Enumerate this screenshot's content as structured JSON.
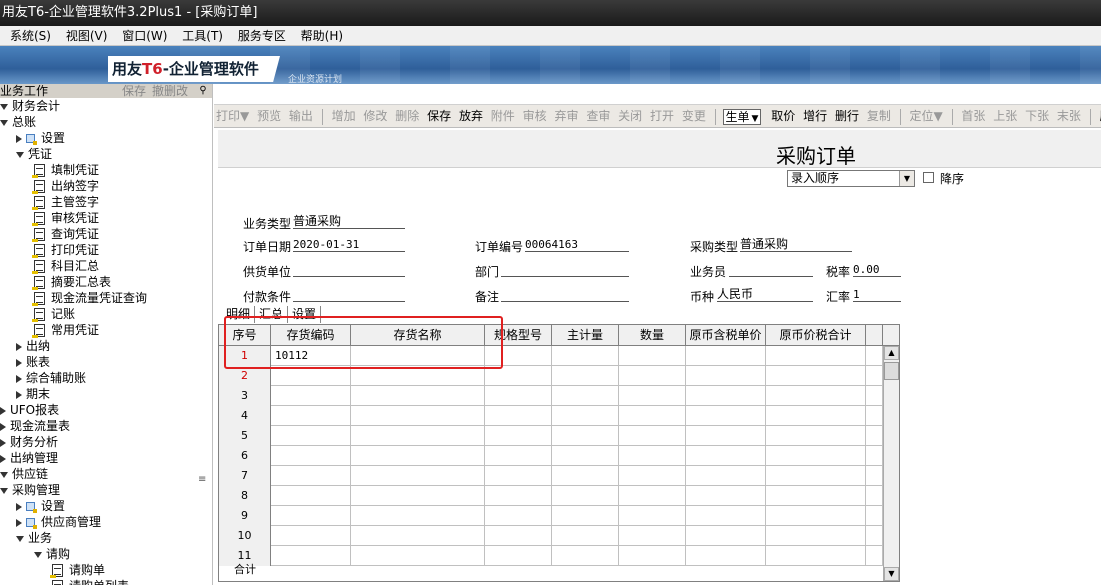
{
  "window": {
    "title": "用友T6-企业管理软件3.2Plus1  - [采购订单]"
  },
  "menu": [
    "系统(S)",
    "视图(V)",
    "窗口(W)",
    "工具(T)",
    "服务专区",
    "帮助(H)"
  ],
  "banner": {
    "logo_pre": "用友",
    "logo_t6": "T6",
    "logo_post": "-企业管理软件",
    "sub": "企业资源计划"
  },
  "nav": {
    "header": "业务工作",
    "save": "保存",
    "undo": "撤删改",
    "items": [
      {
        "label": "财务会计",
        "level": 0,
        "state": "down",
        "icon": "none"
      },
      {
        "label": "总账",
        "level": 1,
        "state": "down",
        "icon": "none"
      },
      {
        "label": "设置",
        "level": 2,
        "state": "right",
        "icon": "folder"
      },
      {
        "label": "凭证",
        "level": 2,
        "state": "down",
        "icon": "none"
      },
      {
        "label": "填制凭证",
        "level": 3,
        "state": "leaf",
        "icon": "doc"
      },
      {
        "label": "出纳签字",
        "level": 3,
        "state": "leaf",
        "icon": "doc"
      },
      {
        "label": "主管签字",
        "level": 3,
        "state": "leaf",
        "icon": "doc"
      },
      {
        "label": "审核凭证",
        "level": 3,
        "state": "leaf",
        "icon": "doc"
      },
      {
        "label": "查询凭证",
        "level": 3,
        "state": "leaf",
        "icon": "doc"
      },
      {
        "label": "打印凭证",
        "level": 3,
        "state": "leaf",
        "icon": "doc"
      },
      {
        "label": "科目汇总",
        "level": 3,
        "state": "leaf",
        "icon": "doc"
      },
      {
        "label": "摘要汇总表",
        "level": 3,
        "state": "leaf",
        "icon": "doc"
      },
      {
        "label": "现金流量凭证查询",
        "level": 3,
        "state": "leaf",
        "icon": "doc"
      },
      {
        "label": "记账",
        "level": 3,
        "state": "leaf",
        "icon": "doc"
      },
      {
        "label": "常用凭证",
        "level": 3,
        "state": "leaf",
        "icon": "doc"
      },
      {
        "label": "出纳",
        "level": 2,
        "state": "right",
        "icon": "none"
      },
      {
        "label": "账表",
        "level": 2,
        "state": "right",
        "icon": "none"
      },
      {
        "label": "综合辅助账",
        "level": 2,
        "state": "right",
        "icon": "none"
      },
      {
        "label": "期末",
        "level": 2,
        "state": "right",
        "icon": "none"
      },
      {
        "label": "UFO报表",
        "level": 1,
        "state": "right",
        "icon": "none"
      },
      {
        "label": "现金流量表",
        "level": 1,
        "state": "right",
        "icon": "none"
      },
      {
        "label": "财务分析",
        "level": 1,
        "state": "right",
        "icon": "none"
      },
      {
        "label": "出纳管理",
        "level": 1,
        "state": "right",
        "icon": "none"
      },
      {
        "label": "供应链",
        "level": 0,
        "state": "down",
        "icon": "none"
      },
      {
        "label": "采购管理",
        "level": 1,
        "state": "down",
        "icon": "none"
      },
      {
        "label": "设置",
        "level": 2,
        "state": "right",
        "icon": "folder"
      },
      {
        "label": "供应商管理",
        "level": 2,
        "state": "right",
        "icon": "folder"
      },
      {
        "label": "业务",
        "level": 2,
        "state": "down",
        "icon": "none"
      },
      {
        "label": "请购",
        "level": 3,
        "state": "down",
        "icon": "none"
      },
      {
        "label": "请购单",
        "level": 4,
        "state": "leaf",
        "icon": "doc"
      },
      {
        "label": "请购单列表",
        "level": 4,
        "state": "leaf",
        "icon": "doc"
      }
    ]
  },
  "toolbar": {
    "print": "打印▼",
    "preview": "预览",
    "output": "输出",
    "add": "增加",
    "modify": "修改",
    "delete": "删除",
    "save": "保存",
    "abandon": "放弃",
    "attach": "附件",
    "audit": "审核",
    "unaudit": "弃审",
    "check": "查审",
    "close": "关闭",
    "open": "打开",
    "change": "变更",
    "generate": "生单",
    "price": "取价",
    "addrow": "增行",
    "delrow": "删行",
    "copy": "复制",
    "locate": "定位▼",
    "first": "首张",
    "prev": "上张",
    "next": "下张",
    "last": "末张",
    "refresh": "刷新"
  },
  "form": {
    "title": "采购订单",
    "sort": "录入顺序",
    "desc_label": "降序",
    "fields": {
      "biz_type_label": "业务类型",
      "biz_type": "普通采购",
      "date_label": "订单日期",
      "date": "2020-01-31",
      "order_no_label": "订单编号",
      "order_no": "00064163",
      "purchase_type_label": "采购类型",
      "purchase_type": "普通采购",
      "supplier_label": "供货单位",
      "supplier": "",
      "dept_label": "部门",
      "dept": "",
      "staff_label": "业务员",
      "staff": "",
      "tax_label": "税率",
      "tax": "0.00",
      "pay_label": "付款条件",
      "pay": "",
      "note_label": "备注",
      "note": "",
      "currency_label": "币种",
      "currency": "人民币",
      "rate_label": "汇率",
      "rate": "1"
    },
    "tabs": [
      "明细",
      "汇总",
      "设置"
    ]
  },
  "grid": {
    "columns": [
      "序号",
      "存货编码",
      "存货名称",
      "规格型号",
      "主计量",
      "数量",
      "原币含税单价",
      "原币价税合计"
    ],
    "rows": [
      {
        "n": "1",
        "code": "10112"
      },
      {
        "n": "2",
        "code": ""
      },
      {
        "n": "3",
        "code": ""
      },
      {
        "n": "4",
        "code": ""
      },
      {
        "n": "5",
        "code": ""
      },
      {
        "n": "6",
        "code": ""
      },
      {
        "n": "7",
        "code": ""
      },
      {
        "n": "8",
        "code": ""
      },
      {
        "n": "9",
        "code": ""
      },
      {
        "n": "10",
        "code": ""
      },
      {
        "n": "11",
        "code": ""
      }
    ],
    "total_label": "合计"
  },
  "colors": {
    "highlight_box": "#e02020",
    "row_num_red": "#d00000"
  }
}
